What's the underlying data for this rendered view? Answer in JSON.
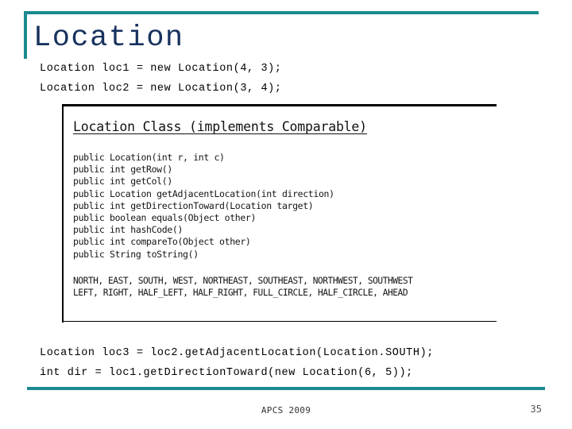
{
  "slide": {
    "title": "Location",
    "accent_color": "#1a8a8f",
    "title_color": "#17325e"
  },
  "code_top": [
    "Location loc1 = new Location(4, 3);",
    "Location loc2 = new Location(3, 4);"
  ],
  "figure": {
    "heading": "Location Class (implements Comparable)",
    "methods": [
      "public Location(int r, int c)",
      "public int getRow()",
      "public int getCol()",
      "public Location getAdjacentLocation(int direction)",
      "public int getDirectionToward(Location target)",
      "public boolean equals(Object other)",
      "public int hashCode()",
      "public int compareTo(Object other)",
      "public String toString()"
    ],
    "constants": [
      "NORTH, EAST, SOUTH, WEST, NORTHEAST, SOUTHEAST, NORTHWEST, SOUTHWEST",
      "LEFT, RIGHT, HALF_LEFT, HALF_RIGHT, FULL_CIRCLE, HALF_CIRCLE, AHEAD"
    ]
  },
  "code_bottom": [
    "Location loc3 = loc2.getAdjacentLocation(Location.SOUTH);",
    "int dir = loc1.getDirectionToward(new Location(6, 5));"
  ],
  "footer": {
    "label": "APCS 2009",
    "page_number": "35"
  }
}
